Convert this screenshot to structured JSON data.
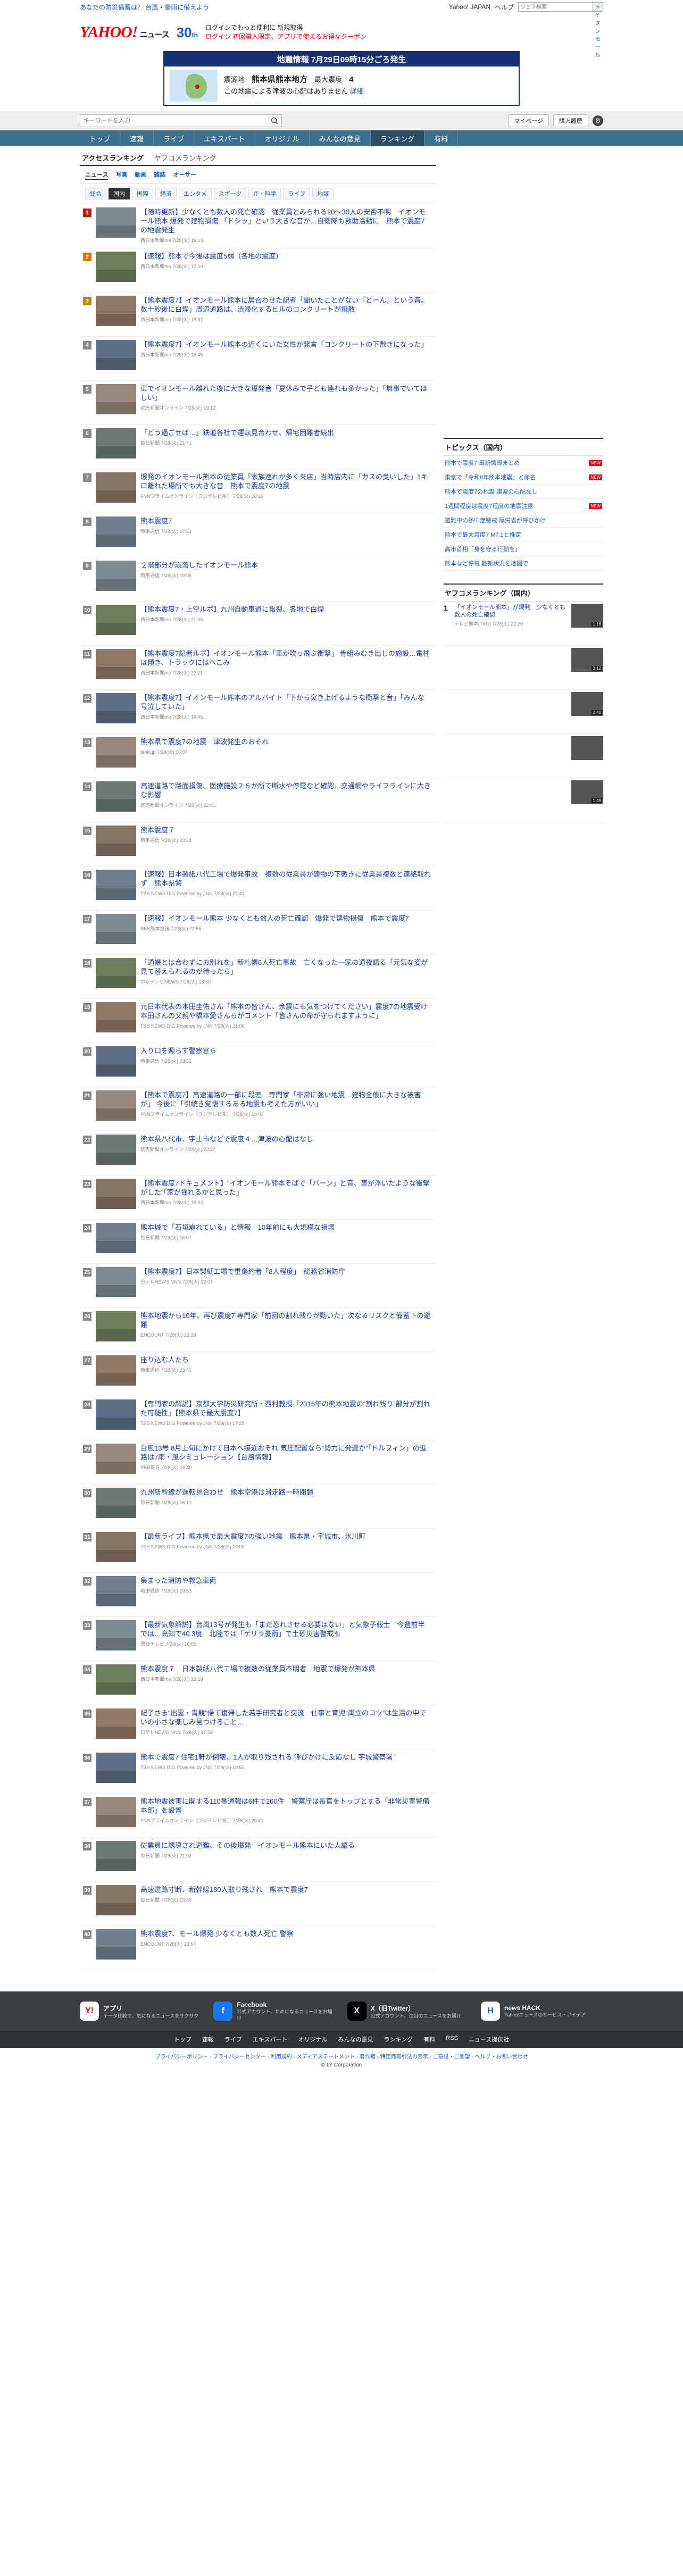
{
  "topbar": {
    "left_text": "あなたの防災備蓄は？ 台風・豪雨に備えよう",
    "links": [
      "Yahoo! JAPAN",
      "ヘルプ"
    ],
    "search_placeholder": "ウェブ検索",
    "search_button": "トイタンモール"
  },
  "header": {
    "logo": "YAHOO!",
    "logo_sub": "JAPAN",
    "section": "ニュース",
    "badge": "30",
    "badge_unit": "th",
    "promo_line1": "ログインでもっと便利に 新規取得",
    "promo_line2": "ログイン 初回購入限定、アプリで使えるお得なクーポン"
  },
  "alert": {
    "heading": "地震情報 7月29日09時15分ごろ発生",
    "region_label": "震源地",
    "region": "熊本県熊本地方",
    "intensity_label": "最大震度",
    "intensity": "4",
    "note": "この地震による津波の心配はありません",
    "link": "詳細"
  },
  "searchbar": {
    "placeholder": "キーワードを入力",
    "links": [
      "マイページ",
      "購入履歴"
    ]
  },
  "nav": {
    "items": [
      "トップ",
      "速報",
      "ライブ",
      "エキスパート",
      "オリジナル",
      "みんなの意見",
      "ランキング",
      "有料"
    ],
    "active": "ランキング"
  },
  "tabs": {
    "primary": [
      "アクセスランキング",
      "ヤフコメランキング"
    ],
    "secondary": [
      "ニュース",
      "写真",
      "動画",
      "雑誌",
      "オーサー"
    ],
    "categories": [
      "総合",
      "国内",
      "国際",
      "経済",
      "エンタメ",
      "スポーツ",
      "IT・科学",
      "ライフ",
      "地域"
    ]
  },
  "ranking": [
    {
      "num": "1",
      "title": "【随時更新】少なくとも数人の死亡確認　従業員とみられる20～30人の安否不明　イオンモール熊本 爆発で建物損傷 「ドシッ」という大きな音が…自衛隊も救助活動に　熊本で震度7の地震発生",
      "meta": "西日本新聞me  7/28(火) 16:13"
    },
    {
      "num": "2",
      "title": "【速報】熊本で今後は震度5弱（各地の震度）",
      "meta": "西日本新聞me  7/28(火) 17:10"
    },
    {
      "num": "3",
      "title": "【熊本震度7】イオンモール熊本に居合わせた記者「聞いたことがない『どーん』という音。数十秒後に白煙」周辺道路は、渋滞化するビルのコンクリートが飛散",
      "meta": "西日本新聞me  7/28(火) 18:37"
    },
    {
      "num": "4",
      "title": "【熊本震度7】イオンモール熊本の近くにいた女性が発言「コンクリートの下敷きになった」",
      "meta": "西日本新聞me  7/28(火) 16:45"
    },
    {
      "num": "5",
      "title": "車でイオンモール離れた後に大きな爆発音「夏休みで子ども連れも多かった」「無事でいてほしい」",
      "meta": "読売新聞オンライン  7/28(火) 19:12"
    },
    {
      "num": "6",
      "title": "「どう過ごせば…」鉄道各社で運転見合わせ、帰宅困難者続出",
      "meta": "毎日新聞  7/28(火) 21:41"
    },
    {
      "num": "7",
      "title": "爆発のイオンモール熊本の従業員「家族連れが多く来店」当時店内に「ガスの臭いした」1キロ離れた場所でも大きな音　熊本で震度7の地震",
      "meta": "FNNプライムオンライン（フジテレビ系）  7/28(火) 20:13"
    },
    {
      "num": "8",
      "title": "熊本震度7",
      "meta": "時事通信  7/28(火) 17:51"
    },
    {
      "num": "9",
      "title": "２階部分が崩落したイオンモール熊本",
      "meta": "時事通信  7/28(火) 19:06"
    },
    {
      "num": "10",
      "title": "【熊本震度7・上空ルポ】九州自動車道に亀裂、各地で白煙",
      "meta": "西日本新聞me  7/28(火) 21:05"
    },
    {
      "num": "11",
      "title": "【熊本震度7記者ルポ】イオンモール熊本「車が吹っ飛ぶ衝撃」 骨組みむき出しの施設…電柱は傾き、トラックにはへこみ",
      "meta": "西日本新聞me  7/28(火) 22:11"
    },
    {
      "num": "12",
      "title": "【熊本震度7】イオンモール熊本のアルバイト「下から突き上げるような衝撃と音」「みんな号泣していた」",
      "meta": "西日本新聞me  7/28(火) 19:45"
    },
    {
      "num": "13",
      "title": "熊本県で震度7の地震　津波発生のおそれ",
      "meta": "tenki.jp  7/28(火) 16:07"
    },
    {
      "num": "14",
      "title": "高速道路で路面損傷、医療施設２６か所で断水や停電など確認…交通網やライフラインに大きな影響",
      "meta": "読売新聞オンライン  7/28(火) 22:41"
    },
    {
      "num": "15",
      "title": "熊本震度７",
      "meta": "時事通信  7/28(火) 23:24"
    },
    {
      "num": "16",
      "title": "【速報】日本製紙八代工場で爆発事故　複数の従業員が建物の下敷きに従業員複数と連絡取れず　熊本県警",
      "meta": "TBS NEWS DIG Powered by JNN  7/28(火) 22:41"
    },
    {
      "num": "17",
      "title": "【速報】イオンモール熊本 少なくとも数人の死亡確認　爆発で建物損傷　熊本で震度7",
      "meta": "RKK熊本放送  7/28(火) 22:55"
    },
    {
      "num": "18",
      "title": "「通帳とは合わずにお別れを」新札幌6人死亡事故　亡くなった一家の通夜語る「元気な姿が見て替えられるのが待ったら」",
      "meta": "中京テレビNEWS  7/28(火) 18:50"
    },
    {
      "num": "19",
      "title": "元日本代表の本田圭佑さん「熊本の皆さん、余震にも気をつけてください」震度7の地震受け 本田さんの父親や橋本愛さんらがコメント「皆さんの命が守られますように」",
      "meta": "TBS NEWS DIG Powered by JNN  7/28(火) 21:06"
    },
    {
      "num": "20",
      "title": "入り口を照らす警察官ら",
      "meta": "時事通信  7/28(火) 23:53"
    },
    {
      "num": "21",
      "title": "【熊本で震度7】高速道路の一部に段差　専門家「非常に強い地震…建物全般に大きな被害が」 今後に「引続き覚悟するある地震も考えた方がいい」",
      "meta": "FNNプライムオンライン（フジテレビ系）  7/28(火) 19:03"
    },
    {
      "num": "22",
      "title": "熊本県八代市、宇土市などで震度４…津波の心配はなし",
      "meta": "読売新聞オンライン  7/28(火) 23:27"
    },
    {
      "num": "23",
      "title": "【熊本震度7ドキュメント】“イオンモール熊本そばで「バーン」と音、車が浮いたような衝撃がした”「家が揺れるかと思った」",
      "meta": "西日本新聞me  7/28(火) 19:23"
    },
    {
      "num": "24",
      "title": "熊本城で「石垣崩れている」と情報　10年前にも大規模な損壊",
      "meta": "毎日新聞  7/28(火) 16:07"
    },
    {
      "num": "25",
      "title": "【熊本震度7】日本製紙工場で重傷約者「8人程度」　総務省消防庁",
      "meta": "日テレNEWS NNN  7/28(火) 22:07"
    },
    {
      "num": "26",
      "title": "熊本地震から10年、再び震度7 専門家「前回の割れ残りが動いた」次なるリスクと備蓄下の避難",
      "meta": "ENCOUNT  7/28(火) 23:18"
    },
    {
      "num": "27",
      "title": "座り込む人たち",
      "meta": "時事通信  7/28(火) 23:41"
    },
    {
      "num": "28",
      "title": "【専門家の解説】京都大学防災研究所・西村教授「2016年の熊本地震の“割れ残り”部分が割れた可能性」【熊本県で最大震度7】",
      "meta": "TBS NEWS DIG Powered by JNN  7/28(火) 17:25"
    },
    {
      "num": "29",
      "title": "台風13号 8月上旬にかけて日本へ接近おそれ 気圧配置なら“勢力に発達か”「ドルフィン」の進路は7雨・風シミュレーション【台風情報】",
      "meta": "RKB毎日  7/28(火) 16:40"
    },
    {
      "num": "30",
      "title": "九州新幹線が運転見合わせ　熊本空港は滑走路一時閉鎖",
      "meta": "毎日新聞  7/28(火) 16:10"
    },
    {
      "num": "31",
      "title": "【最新ライブ】熊本県で最大震度7の強い地震　熊本県・宇城市、氷川町",
      "meta": "TBS NEWS DIG Powered by JNN  7/28(火) 16:00"
    },
    {
      "num": "32",
      "title": "集まった消防や救急車両",
      "meta": "時事通信  7/28(火) 19:53"
    },
    {
      "num": "33",
      "title": "【最新気象解説】台風13号が発生も「まだ恐れさせる必要はない」と気象予報士　今週前半では…高知で40.3度　北陸では「ゲリラ豪雨」で土砂災害警戒も",
      "meta": "関西テレビ  7/28(火) 16:05"
    },
    {
      "num": "34",
      "title": "熊本震度７　日本製紙八代工場で複数の従業員不明者　地震で爆発が熊本県",
      "meta": "西日本新聞me  7/28(火) 23:19"
    },
    {
      "num": "35",
      "title": "紀子さま“出雲・青競”帰て復帰した若手研究者と交流　仕事と育児“両立のコツ”は生活の中でいの小さな楽しみ見つけること…",
      "meta": "日テレNEWS NNN  7/28(火) 17:58"
    },
    {
      "num": "36",
      "title": "熊本で震度7 住宅1軒が倒壊、1人が取り残される 呼びかけに反応なし 宇城警察署",
      "meta": "TBS NEWS DIG Powered by JNN  7/28(火) 18:52"
    },
    {
      "num": "37",
      "title": "熊本地震被害に関する110番通報は6件で260件　警察庁は長官をトップとする「非常災害警備本部」を設置",
      "meta": "FNNプライムオンライン（フジテレビ系）  7/28(火) 20:41"
    },
    {
      "num": "38",
      "title": "従業員に誘導され避難、その後爆発　イオンモール熊本にいた人語る",
      "meta": "毎日新聞  7/28(火) 21:02"
    },
    {
      "num": "39",
      "title": "高速道路寸断、新幹線180人取り残され　熊本で震度7",
      "meta": "毎日新聞  7/28(火) 23:46"
    },
    {
      "num": "40",
      "title": "熊本震度7、モール爆発 少なくとも数人死亡 警察",
      "meta": "ENCOUNT  7/28(火) 23:54"
    }
  ],
  "topics": {
    "heading": "トピックス（国内）",
    "items": [
      {
        "text": "熊本で震度7 最新情報まとめ",
        "tag": "NEW"
      },
      {
        "text": "東京で「令和8年熊本地震」と命名",
        "tag": "NEW"
      },
      {
        "text": "熊本で震度7の地震 津波の心配なし",
        "tag": ""
      },
      {
        "text": "1週間程度は震度7程度の地震注意",
        "tag": "NEW"
      },
      {
        "text": "避難中の熱中症警戒 厚労省が呼びかけ",
        "tag": ""
      },
      {
        "text": "熊本で最大震度7 M7.1と推定",
        "tag": ""
      },
      {
        "text": "高市首相「身を守る行動を」",
        "tag": ""
      },
      {
        "text": "熊本など停電 最新状況を地図で",
        "tag": ""
      }
    ]
  },
  "yahoo_comment_ranking": {
    "heading": "ヤフコメランキング（国内）",
    "items": [
      {
        "num": "1",
        "title": "「イオンモール熊本」が爆発　少なくとも数人の死亡確認",
        "meta": "テレビ熊本(TKU)  7/28(火) 22:20",
        "duration": "1:16"
      },
      {
        "num": "",
        "title": "",
        "meta": "",
        "duration": "3:12"
      },
      {
        "num": "",
        "title": "",
        "meta": "",
        "duration": "2:40"
      },
      {
        "num": "",
        "title": "",
        "meta": "",
        "duration": ""
      },
      {
        "num": "",
        "title": "",
        "meta": "",
        "duration": "1:49"
      }
    ]
  },
  "footer": {
    "apps": [
      {
        "title": "アプリ",
        "desc": "データ比較で、気になるニュースをサクサク",
        "icon": "Y!"
      },
      {
        "title": "Facebook",
        "desc": "公式アカウント、ためになるニュースをお届け",
        "icon": "f"
      },
      {
        "title": "X（旧Twitter）",
        "desc": "公式アカウント、注目のニュースをお届け",
        "icon": "X"
      },
      {
        "title": "news HACK",
        "desc": "Yahoo!ニュースのサービス・アイデア",
        "icon": "H"
      }
    ],
    "nav": [
      "トップ",
      "速報",
      "ライブ",
      "エキスパート",
      "オリジナル",
      "みんなの意見",
      "ランキング",
      "有料",
      "RSS",
      "ニュース提供社"
    ],
    "bottom_links": "プライバシーポリシー - プライバシーセンター - 利用規約 - メディアステートメント - 著作権 - 特定商取引法の表示 - ご意見・ご要望 - ヘルプ・お問い合わせ",
    "copyright": "© LY Corporation"
  },
  "colors": {
    "nav_bg": "#3f6f8f",
    "alert_bg": "#1a2f74",
    "link": "#1a3c8f",
    "rank1": "#c31a1a",
    "footer_bg": "#3a3f44"
  }
}
